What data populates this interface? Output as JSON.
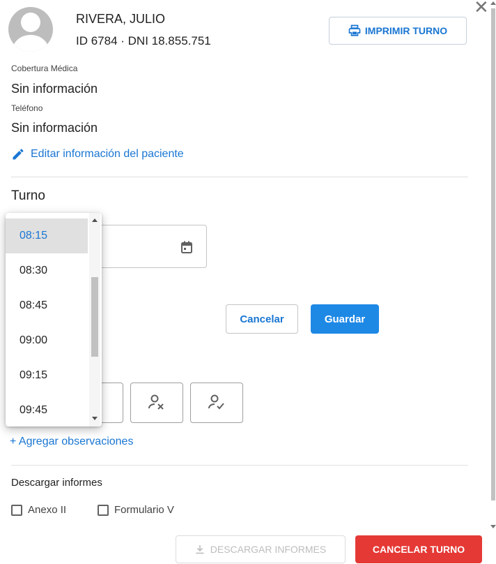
{
  "patient": {
    "name": "RIVERA, JULIO",
    "ids": "ID 6784 · DNI 18.855.751"
  },
  "header": {
    "print_label": "IMPRIMIR TURNO",
    "close_glyph": "✕"
  },
  "fields": {
    "coverage_label": "Cobertura Médica",
    "coverage_value": "Sin información",
    "phone_label": "Teléfono",
    "phone_value": "Sin información"
  },
  "edit_link": "Editar información del paciente",
  "turno": {
    "title": "Turno",
    "cancel_label": "Cancelar",
    "save_label": "Guardar"
  },
  "time_dropdown": {
    "selected": "08:15",
    "options": [
      "08:15",
      "08:30",
      "08:45",
      "09:00",
      "09:15",
      "09:45"
    ]
  },
  "observations_link": "+ Agregar observaciones",
  "downloads": {
    "title": "Descargar informes",
    "options": [
      "Anexo II",
      "Formulario V"
    ],
    "download_label": "DESCARGAR INFORMES",
    "cancel_turno_label": "CANCELAR TURNO"
  },
  "icons": [
    "user-avatar-icon",
    "close-icon",
    "printer-icon",
    "pencil-icon",
    "calendar-icon",
    "person-x-icon",
    "person-check-icon",
    "download-icon"
  ],
  "colors": {
    "accent": "#1976d2",
    "save_bg": "#1e88e5",
    "danger": "#e53935"
  }
}
